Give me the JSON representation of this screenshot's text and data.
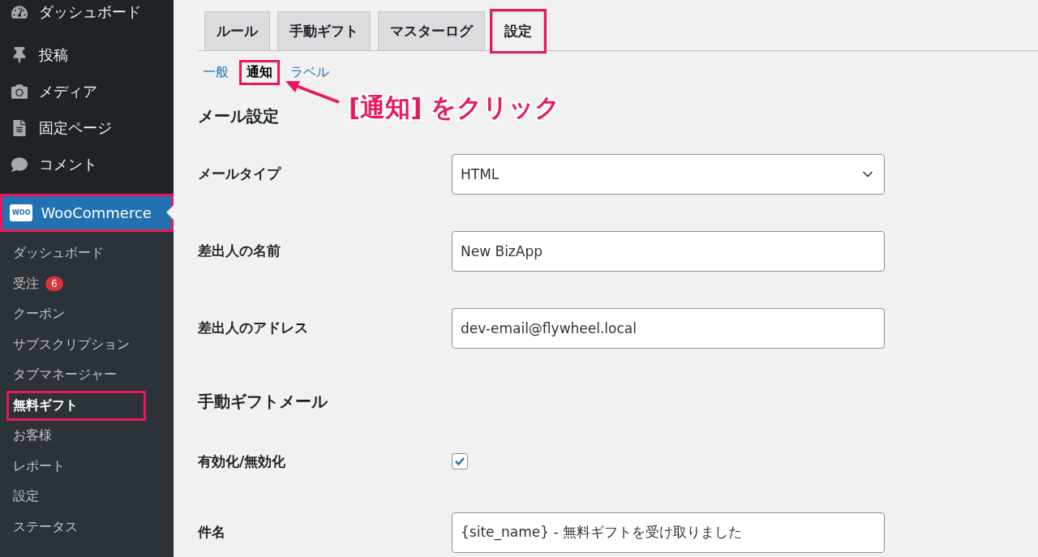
{
  "sidebar": {
    "menu": [
      {
        "kind": "dashboard",
        "label": "ダッシュボード"
      },
      {
        "kind": "pin",
        "label": "投稿"
      },
      {
        "kind": "media",
        "label": "メディア"
      },
      {
        "kind": "page",
        "label": "固定ページ"
      },
      {
        "kind": "comment",
        "label": "コメント"
      }
    ],
    "woocommerce": {
      "logo": "WOO",
      "label": "WooCommerce",
      "highlighted": true
    },
    "submenu": [
      {
        "label": "ダッシュボード",
        "selected": false,
        "highlighted": false
      },
      {
        "label": "受注",
        "badge": "6",
        "selected": false,
        "highlighted": false
      },
      {
        "label": "クーポン",
        "selected": false,
        "highlighted": false
      },
      {
        "label": "サブスクリプション",
        "selected": false,
        "highlighted": false
      },
      {
        "label": "タブマネージャー",
        "selected": false,
        "highlighted": false
      },
      {
        "label": "無料ギフト",
        "selected": true,
        "highlighted": true
      },
      {
        "label": "お客様",
        "selected": false,
        "highlighted": false
      },
      {
        "label": "レポート",
        "selected": false,
        "highlighted": false
      },
      {
        "label": "設定",
        "selected": false,
        "highlighted": false
      },
      {
        "label": "ステータス",
        "selected": false,
        "highlighted": false
      }
    ]
  },
  "tabs": [
    {
      "label": "ルール",
      "selected": false,
      "highlighted": false
    },
    {
      "label": "手動ギフト",
      "selected": false,
      "highlighted": false
    },
    {
      "label": "マスターログ",
      "selected": false,
      "highlighted": false
    },
    {
      "label": "設定",
      "selected": true,
      "highlighted": true
    }
  ],
  "subtabs": [
    {
      "label": "一般",
      "selected": false,
      "highlighted": false
    },
    {
      "label": "通知",
      "selected": true,
      "highlighted": true
    },
    {
      "label": "ラベル",
      "selected": false,
      "highlighted": false
    }
  ],
  "callout": {
    "text": "[通知] をクリック"
  },
  "sections": [
    {
      "heading": "メール設定",
      "fields": [
        {
          "kind": "select",
          "label": "メールタイプ",
          "value": "HTML"
        },
        {
          "kind": "text",
          "label": "差出人の名前",
          "value": "New BizApp"
        },
        {
          "kind": "text",
          "label": "差出人のアドレス",
          "value": "dev-email@flywheel.local"
        }
      ]
    },
    {
      "heading": "手動ギフトメール",
      "fields": [
        {
          "kind": "checkbox",
          "label": "有効化/無効化",
          "checked": true
        },
        {
          "kind": "text",
          "label": "件名",
          "value": "{site_name} - 無料ギフトを受け取りました"
        }
      ]
    }
  ]
}
